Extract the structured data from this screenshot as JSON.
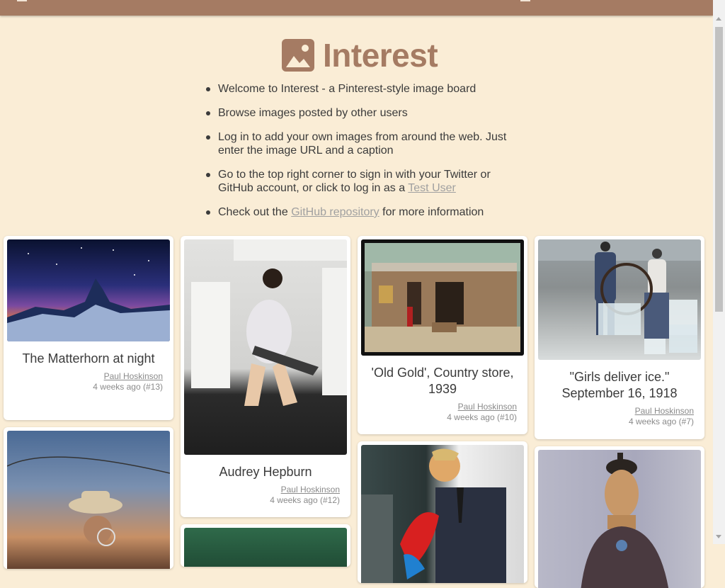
{
  "nav": {
    "menu_icon": "menu-icon",
    "login_icon": "login-icon"
  },
  "brand": {
    "icon": "image-icon",
    "title": "Interest",
    "color": "#a57b63"
  },
  "intro": {
    "item1": "Welcome to Interest - a Pinterest-style image board",
    "item2": "Browse images posted by other users",
    "item3": "Log in to add your own images from around the web. Just enter the image URL and a caption",
    "item4_prefix": "Go to the top right corner to sign in with your Twitter or GitHub account, or click to log in as a",
    "item4_link": "Test User",
    "item5_prefix": "Check out the",
    "item5_link": "GitHub repository",
    "item5_suffix": "for more information"
  },
  "cards": [
    {
      "caption": "The Matterhorn at night",
      "author": "Paul Hoskinson",
      "meta": "4 weeks ago (#13)"
    },
    {
      "caption": "Audrey Hepburn",
      "author": "Paul Hoskinson",
      "meta": "4 weeks ago (#12)"
    },
    {
      "caption": "'Old Gold', Country store, 1939",
      "author": "Paul Hoskinson",
      "meta": "4 weeks ago (#10)"
    },
    {
      "caption": "\"Girls deliver ice.\" September 16, 1918",
      "author": "Paul Hoskinson",
      "meta": "4 weeks ago (#7)"
    }
  ],
  "colors": {
    "background": "#faedd6",
    "topbar": "#a57b63",
    "card": "#ffffff",
    "link": "#a0a0a0"
  }
}
